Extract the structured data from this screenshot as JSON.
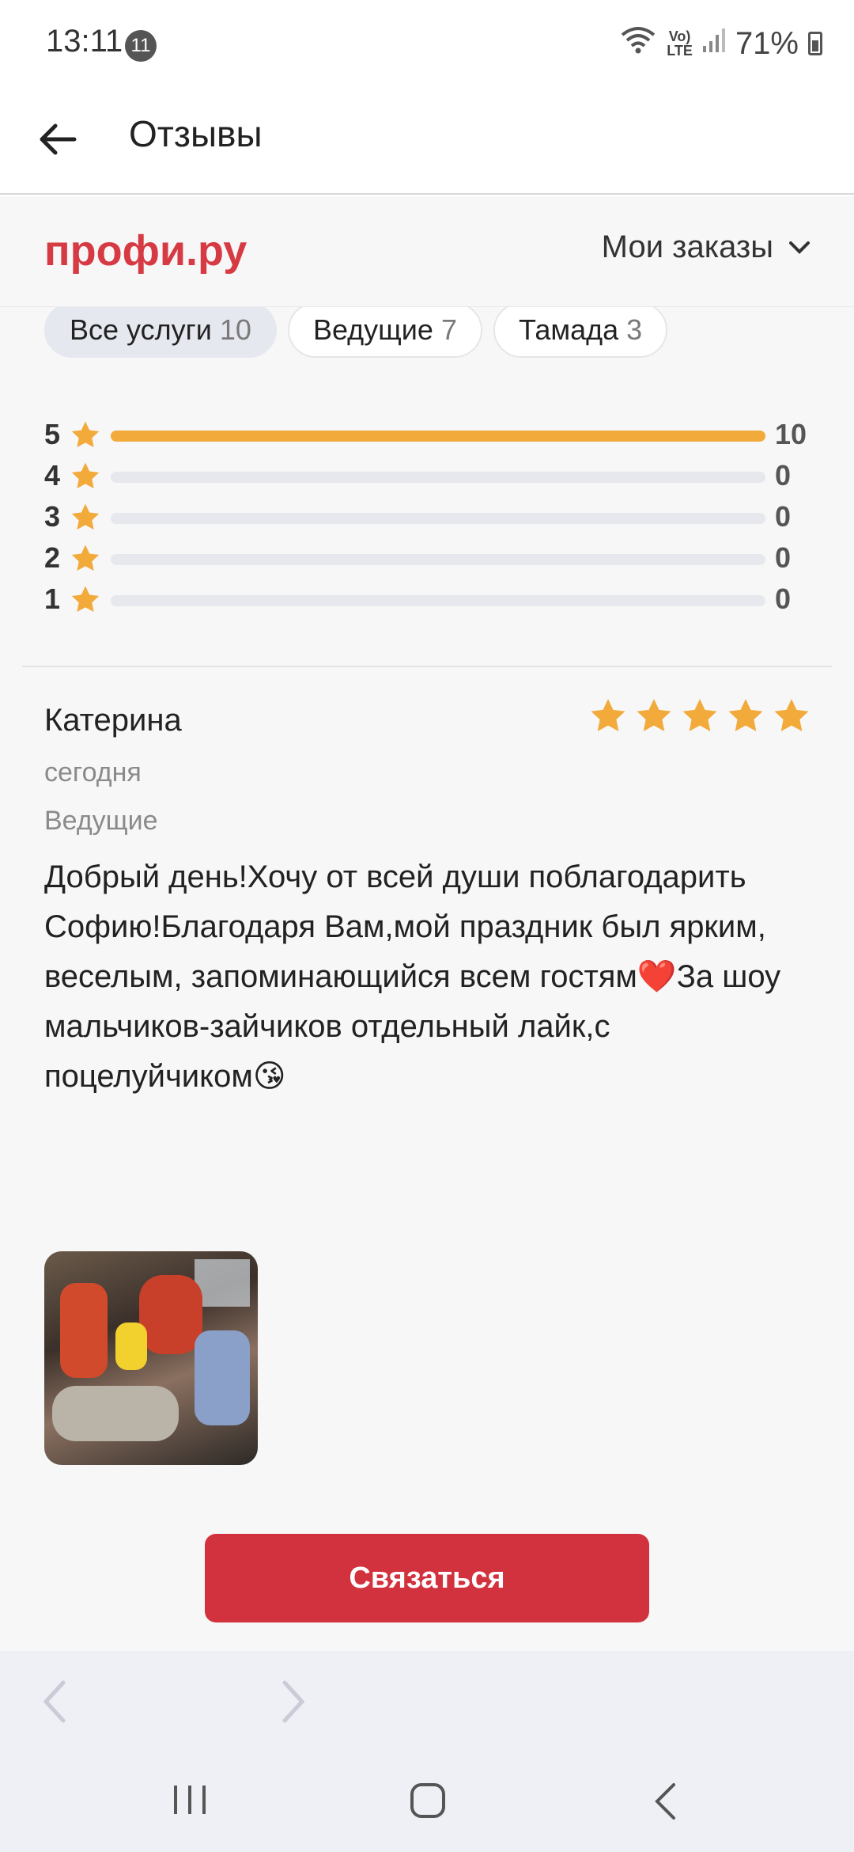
{
  "status_bar": {
    "time": "13:11",
    "notification_count": "11",
    "lte_label_1": "Vo)",
    "lte_label_2": "LTE",
    "battery": "71%"
  },
  "app_bar": {
    "title": "Отзывы",
    "back_icon": "arrow-left-icon"
  },
  "brand": {
    "logo": "профи.ру",
    "orders_label": "Мои заказы",
    "orders_icon": "chevron-down-icon",
    "accent_color": "#d63a43"
  },
  "filters": [
    {
      "label": "Все услуги",
      "count": "10",
      "active": true
    },
    {
      "label": "Ведущие",
      "count": "7",
      "active": false
    },
    {
      "label": "Тамада",
      "count": "3",
      "active": false
    }
  ],
  "rating_breakdown": [
    {
      "stars": "5",
      "count": "10",
      "fraction": 1.0
    },
    {
      "stars": "4",
      "count": "0",
      "fraction": 0
    },
    {
      "stars": "3",
      "count": "0",
      "fraction": 0
    },
    {
      "stars": "2",
      "count": "0",
      "fraction": 0
    },
    {
      "stars": "1",
      "count": "0",
      "fraction": 0
    }
  ],
  "review": {
    "author": "Катерина",
    "rating": 5,
    "date": "сегодня",
    "category": "Ведущие",
    "text": "Добрый день!Хочу от всей души поблагодарить Софию!Благодаря Вам,мой праздник был ярким, веселым, запоминающийся всем гостям❤️За шоу мальчиков-зайчиков отдельный лайк,с поцелуйчиком😘"
  },
  "actions": {
    "contact_label": "Связаться",
    "contact_color": "#d2323e"
  },
  "star_color": "#f2aa3b"
}
